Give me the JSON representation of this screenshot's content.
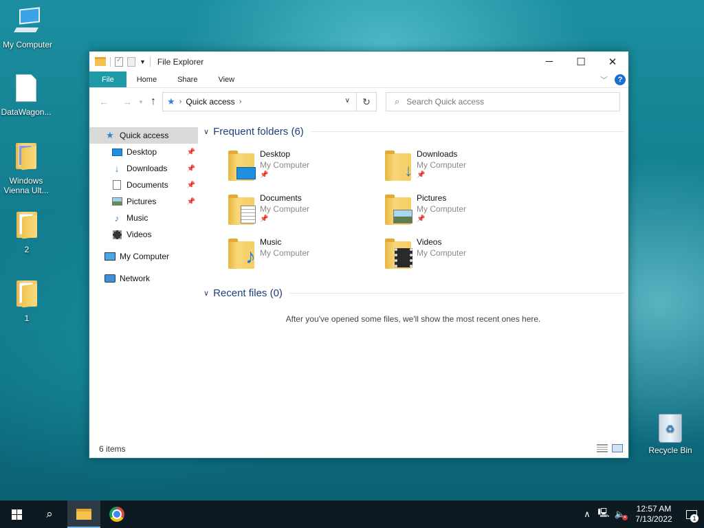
{
  "desktop": {
    "icons": [
      {
        "label": "My Computer",
        "icon": "computer-icon"
      },
      {
        "label": "DataWagon...",
        "icon": "document-icon"
      },
      {
        "label": "Windows Vienna Ult...",
        "icon": "folder-icon"
      },
      {
        "label": "2",
        "icon": "folder-icon"
      },
      {
        "label": "1",
        "icon": "folder-icon"
      }
    ],
    "recycle_bin": {
      "label": "Recycle Bin",
      "icon": "recycle-bin-icon"
    }
  },
  "window": {
    "title": "File Explorer",
    "controls": {
      "minimize": "─",
      "maximize": "☐",
      "close": "✕"
    },
    "ribbon_tabs": [
      "File",
      "Home",
      "Share",
      "View"
    ],
    "address": {
      "path": "Quick access"
    },
    "search": {
      "placeholder": "Search Quick access"
    },
    "nav_pane": {
      "quick_access": "Quick access",
      "items": [
        {
          "label": "Desktop",
          "icon": "desktop-icon",
          "pinned": true
        },
        {
          "label": "Downloads",
          "icon": "downloads-icon",
          "pinned": true
        },
        {
          "label": "Documents",
          "icon": "documents-icon",
          "pinned": true
        },
        {
          "label": "Pictures",
          "icon": "pictures-icon",
          "pinned": true
        },
        {
          "label": "Music",
          "icon": "music-icon",
          "pinned": false
        },
        {
          "label": "Videos",
          "icon": "videos-icon",
          "pinned": false
        }
      ],
      "my_computer": "My Computer",
      "network": "Network"
    },
    "frequent_folders": {
      "header": "Frequent folders (6)",
      "items": [
        {
          "name": "Desktop",
          "location": "My Computer",
          "pinned": true,
          "icon": "desktop-folder-icon"
        },
        {
          "name": "Downloads",
          "location": "My Computer",
          "pinned": true,
          "icon": "downloads-folder-icon"
        },
        {
          "name": "Documents",
          "location": "My Computer",
          "pinned": true,
          "icon": "documents-folder-icon"
        },
        {
          "name": "Pictures",
          "location": "My Computer",
          "pinned": true,
          "icon": "pictures-folder-icon"
        },
        {
          "name": "Music",
          "location": "My Computer",
          "pinned": false,
          "icon": "music-folder-icon"
        },
        {
          "name": "Videos",
          "location": "My Computer",
          "pinned": false,
          "icon": "videos-folder-icon"
        }
      ]
    },
    "recent_files": {
      "header": "Recent files (0)",
      "empty_message": "After you've opened some files, we'll show the most recent ones here."
    },
    "status": {
      "item_count": "6 items"
    }
  },
  "taskbar": {
    "clock": {
      "time": "12:57 AM",
      "date": "7/13/2022"
    },
    "notification_count": "1"
  },
  "colors": {
    "ribbon_file_tab": "#1e9aa7",
    "group_header": "#1e3f7a",
    "taskbar": "#0e1a22"
  }
}
